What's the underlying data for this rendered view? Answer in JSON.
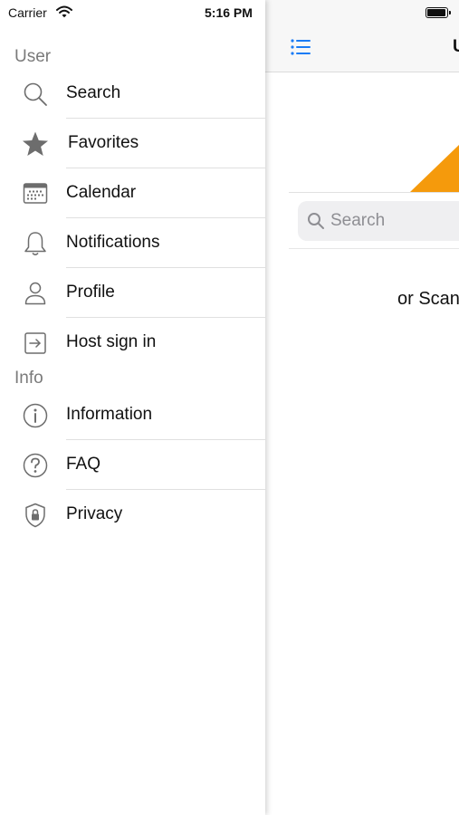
{
  "status": {
    "carrier": "Carrier",
    "time": "5:16 PM"
  },
  "sidebar": {
    "sections": [
      {
        "title": "User",
        "items": [
          {
            "label": "Search",
            "icon": "search-icon"
          },
          {
            "label": "Favorites",
            "icon": "star-icon"
          },
          {
            "label": "Calendar",
            "icon": "calendar-icon"
          },
          {
            "label": "Notifications",
            "icon": "bell-icon"
          },
          {
            "label": "Profile",
            "icon": "person-icon"
          },
          {
            "label": "Host sign in",
            "icon": "sign-in-icon"
          }
        ]
      },
      {
        "title": "Info",
        "items": [
          {
            "label": "Information",
            "icon": "info-icon"
          },
          {
            "label": "FAQ",
            "icon": "question-icon"
          },
          {
            "label": "Privacy",
            "icon": "shield-lock-icon"
          }
        ]
      }
    ]
  },
  "main": {
    "title_partial": "U",
    "search": {
      "placeholder": "Search"
    },
    "scan_text_partial": "or Scan"
  },
  "colors": {
    "accent": "#1a7cf5",
    "orange": "#f59a0c",
    "icon_gray": "#6d6d6d"
  }
}
